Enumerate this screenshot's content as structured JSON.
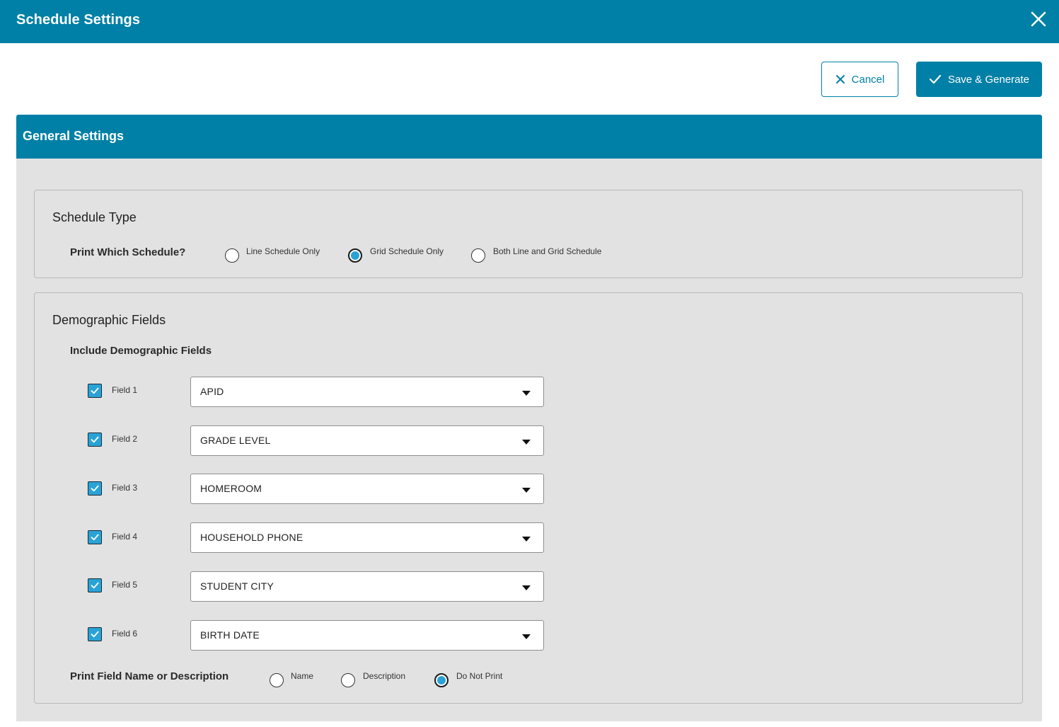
{
  "dialog": {
    "title": "Schedule Settings"
  },
  "toolbar": {
    "cancel_label": "Cancel",
    "save_label": "Save & Generate"
  },
  "general": {
    "header": "General Settings"
  },
  "schedule_type": {
    "title": "Schedule Type",
    "question": "Print Which Schedule?",
    "options": [
      {
        "label": "Line Schedule Only",
        "checked": false
      },
      {
        "label": "Grid Schedule Only",
        "checked": true
      },
      {
        "label": "Both Line and Grid Schedule",
        "checked": false
      }
    ]
  },
  "demographic": {
    "title": "Demographic Fields",
    "include_label": "Include Demographic Fields",
    "fields": [
      {
        "label": "Field 1",
        "checked": true,
        "value": "APID"
      },
      {
        "label": "Field 2",
        "checked": true,
        "value": "GRADE LEVEL"
      },
      {
        "label": "Field 3",
        "checked": true,
        "value": "HOMEROOM"
      },
      {
        "label": "Field 4",
        "checked": true,
        "value": "HOUSEHOLD PHONE"
      },
      {
        "label": "Field 5",
        "checked": true,
        "value": "STUDENT CITY"
      },
      {
        "label": "Field 6",
        "checked": true,
        "value": "BIRTH DATE"
      }
    ],
    "print_label": "Print Field Name or Description",
    "print_options": [
      {
        "label": "Name",
        "checked": false
      },
      {
        "label": "Description",
        "checked": false
      },
      {
        "label": "Do Not Print",
        "checked": true
      }
    ]
  },
  "colors": {
    "accent": "#0080a6",
    "radio_fill": "#29a3d6",
    "panel_bg": "#e2e2e2"
  },
  "icons": {
    "close": "close-icon",
    "cancel": "x-icon",
    "save": "check-icon",
    "checkbox": "check-icon"
  }
}
